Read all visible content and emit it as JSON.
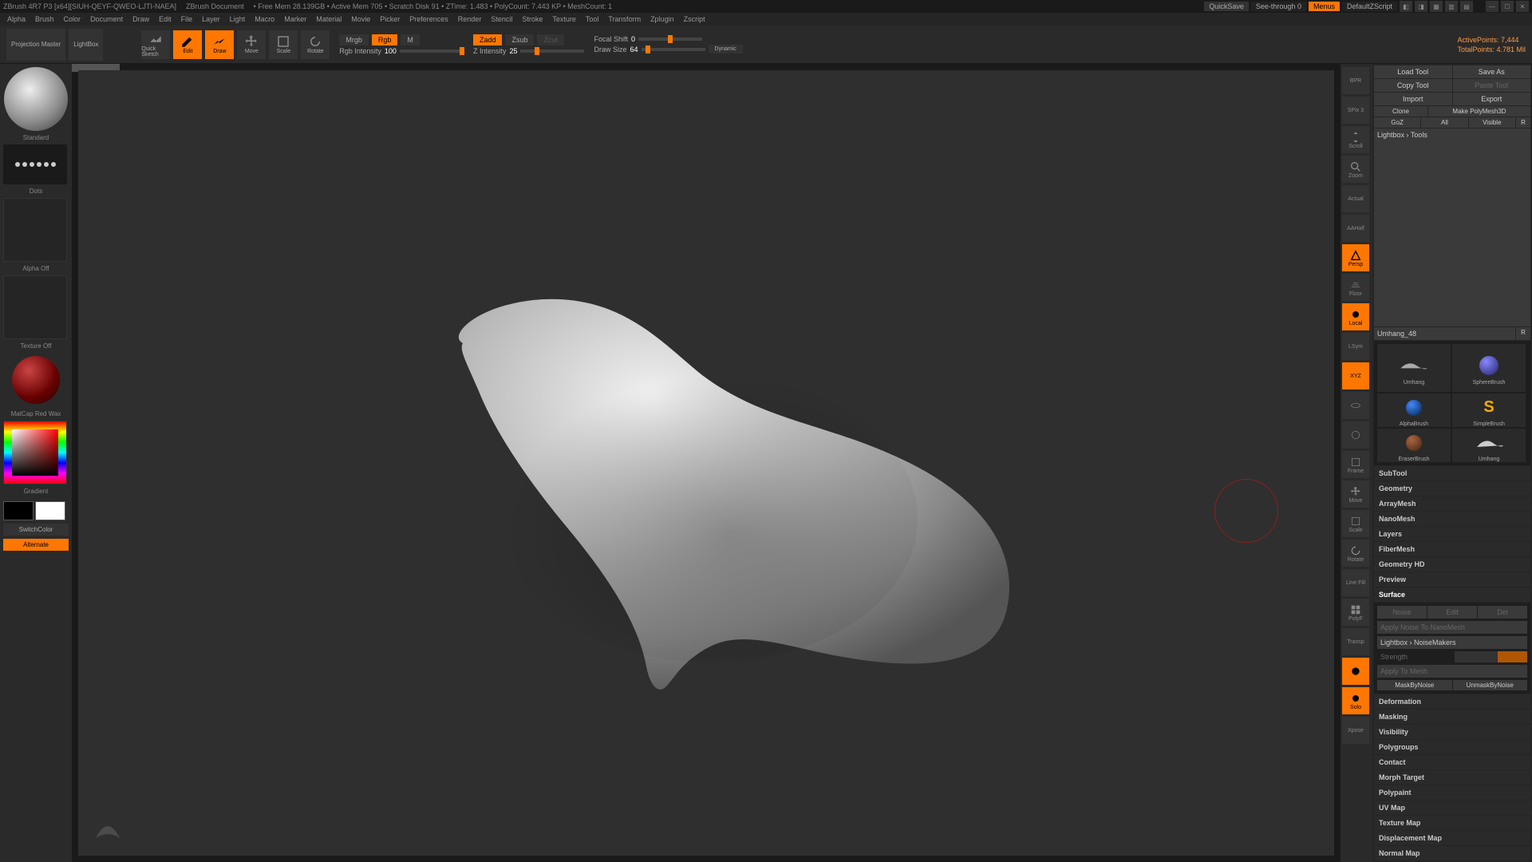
{
  "titlebar": {
    "app": "ZBrush 4R7 P3 [x64][SIUH-QEYF-QWEO-LJTI-NAEA]",
    "doc": "ZBrush Document",
    "mem": "• Free Mem 28.139GB • Active Mem 705 • Scratch Disk 91 • ZTime: 1.483 • PolyCount: 7.443 KP • MeshCount: 1",
    "quicksave": "QuickSave",
    "seethrough": "See-through  0",
    "menus": "Menus",
    "script": "DefaultZScript"
  },
  "menubar": [
    "Alpha",
    "Brush",
    "Color",
    "Document",
    "Draw",
    "Edit",
    "File",
    "Layer",
    "Light",
    "Macro",
    "Marker",
    "Material",
    "Movie",
    "Picker",
    "Preferences",
    "Render",
    "Stencil",
    "Stroke",
    "Texture",
    "Tool",
    "Transform",
    "Zplugin",
    "Zscript"
  ],
  "toolbar": {
    "projection": "Projection\nMaster",
    "lightbox": "LightBox",
    "quicksketch": "Quick\nSketch",
    "edit": "Edit",
    "draw": "Draw",
    "move": "Move",
    "scale": "Scale",
    "rotate": "Rotate",
    "mrgb": "Mrgb",
    "rgb": "Rgb",
    "m": "M",
    "rgb_intensity_label": "Rgb Intensity",
    "rgb_intensity_val": "100",
    "zadd": "Zadd",
    "zsub": "Zsub",
    "zcut": "Zcut",
    "z_intensity_label": "Z Intensity",
    "z_intensity_val": "25",
    "focal_label": "Focal Shift",
    "focal_val": "0",
    "drawsize_label": "Draw Size",
    "drawsize_val": "64",
    "dynamic": "Dynamic",
    "active_points": "ActivePoints: 7,444",
    "total_points": "TotalPoints: 4.781 Mil"
  },
  "left": {
    "brush_name": "Standard",
    "stroke_name": "Dots",
    "alpha_label": "Alpha Off",
    "texture_label": "Texture Off",
    "material_label": "MatCap Red Wax",
    "gradient": "Gradient",
    "switchcolor": "SwitchColor",
    "alternate": "Alternate"
  },
  "side": {
    "items": [
      "BPR",
      "SPix 3",
      "Scroll",
      "Zoom",
      "Actual",
      "AAHalf",
      "Persp",
      "Floor",
      "Local",
      "LSym",
      "XYZ",
      "",
      "",
      "Frame",
      "Move",
      "Scale",
      "Rotate",
      "Line Fill",
      "PolyF",
      "Transp",
      "",
      "Solo",
      "Xpose"
    ]
  },
  "right": {
    "load": "Load Tool",
    "saveas": "Save As",
    "copy": "Copy Tool",
    "paste": "Paste Tool",
    "import": "Import",
    "export": "Export",
    "clone": "Clone",
    "makepoly": "Make PolyMesh3D",
    "goz": "GoZ",
    "all": "All",
    "visible": "Visible",
    "r1": "R",
    "lightbox_tools": "Lightbox › Tools",
    "toolname": "Umhang_48",
    "r2": "R",
    "thumbs": [
      "Umhang",
      "SphereBrush",
      "AlphaBrush",
      "SimpleBrush",
      "EraserBrush",
      "Umhang"
    ],
    "sections": [
      "SubTool",
      "Geometry",
      "ArrayMesh",
      "NanoMesh",
      "Layers",
      "FiberMesh",
      "Geometry HD",
      "Preview"
    ],
    "surface": "Surface",
    "noise": "Noise",
    "noise_edit": "Edit",
    "noise_del": "Del",
    "apply_nano": "Apply Noise To NanoMesh",
    "lightbox_noise": "Lightbox › NoiseMakers",
    "strength": "Strength",
    "apply_mesh": "Apply To Mesh",
    "maskbynoise": "MaskByNoise",
    "unmaskbynoise": "UnmaskByNoise",
    "sections2": [
      "Deformation",
      "Masking",
      "Visibility",
      "Polygroups",
      "Contact",
      "Morph Target",
      "Polypaint",
      "UV Map",
      "Texture Map",
      "Displacement Map",
      "Normal Map"
    ]
  }
}
